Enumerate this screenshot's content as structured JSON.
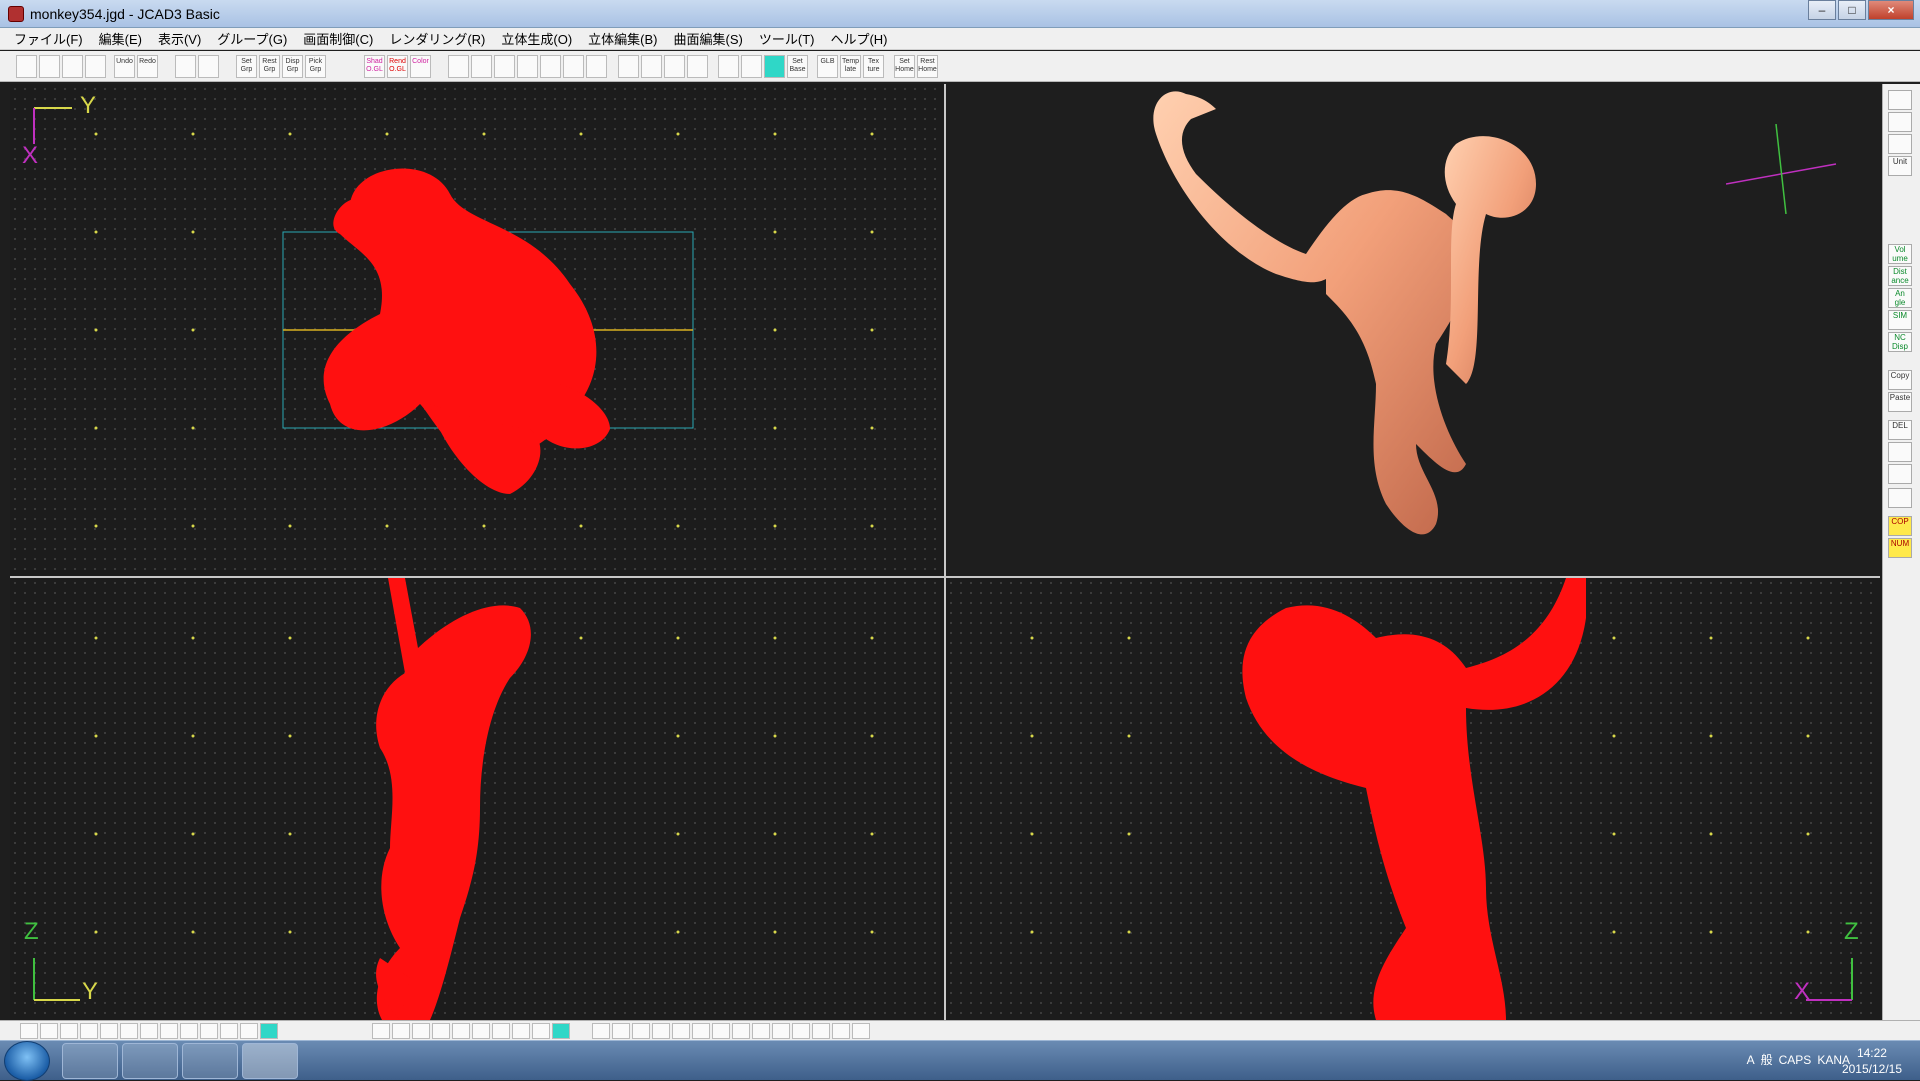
{
  "window": {
    "title": "monkey354.jgd - JCAD3 Basic",
    "minimize": "–",
    "maximize": "□",
    "close": "×"
  },
  "menu": [
    "ファイル(F)",
    "編集(E)",
    "表示(V)",
    "グループ(G)",
    "画面制御(C)",
    "レンダリング(R)",
    "立体生成(O)",
    "立体編集(B)",
    "曲面編集(S)",
    "ツール(T)",
    "ヘルプ(H)"
  ],
  "toolbar": {
    "set_grp": "Set Grp",
    "rest_grp": "Rest Grp",
    "disp_grp": "Disp Grp",
    "pick_grp": "Pick Grp",
    "undo": "Undo",
    "redo": "Redo",
    "shad_o": "Shad O.GL",
    "rend_o": "Rend O.GL",
    "color": "Color",
    "set_base": "Set Base",
    "glb": "GLB",
    "template": "Temp late",
    "texture": "Tex ture",
    "set_home": "Set Home",
    "rest_home": "Rest Home"
  },
  "viewports": {
    "top": {
      "axis_y": "Y",
      "axis_x": "X"
    },
    "front": {
      "axis_z": "Z",
      "axis_y": "Y"
    },
    "side": {
      "axis_z": "Z",
      "axis_x": "X"
    }
  },
  "sidebar": {
    "unit": "Unit",
    "volume": "Vol ume",
    "distance": "Dist ance",
    "angle": "An gle",
    "sim": "SIM",
    "nc_disp": "NC Disp",
    "copy": "Copy",
    "paste": "Paste",
    "del": "DEL",
    "cop": "COP",
    "num": "NUM"
  },
  "colors": {
    "wireframe": "#ff1010",
    "render": "#f2a07a",
    "grid": "#2aa8b4",
    "axis_y": "#d8d84a",
    "axis_x": "#c030c0",
    "axis_z": "#40c040"
  },
  "tray": {
    "ime_a": "A",
    "ime_kan": "般",
    "caps": "CAPS",
    "kana": "KANA"
  },
  "clock": {
    "time": "14:22",
    "date": "2015/12/15"
  }
}
